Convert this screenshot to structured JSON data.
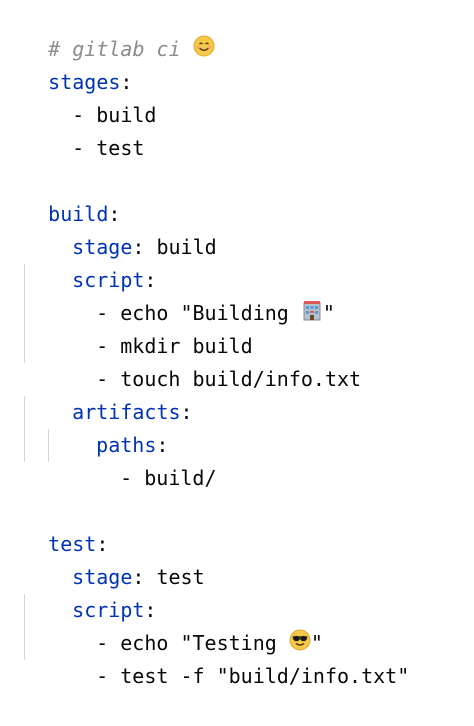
{
  "editor": {
    "language": "yaml",
    "lines": [
      {
        "id": "l1",
        "comment": "# gitlab ci ",
        "icon": "smiling-face-icon"
      },
      {
        "id": "l2",
        "key": "stages",
        "sep": ":"
      },
      {
        "id": "l3",
        "text": "- build"
      },
      {
        "id": "l4",
        "text": "- test"
      },
      {
        "id": "l5",
        "text": ""
      },
      {
        "id": "l6",
        "key": "build",
        "sep": ":"
      },
      {
        "id": "l7",
        "key": "stage",
        "sep": ":",
        "value": " build"
      },
      {
        "id": "l8",
        "key": "script",
        "sep": ":"
      },
      {
        "id": "l9",
        "text": "- echo \"Building ",
        "icon": "hotel-building-icon",
        "text_after": "\""
      },
      {
        "id": "l10",
        "text": "- mkdir build"
      },
      {
        "id": "l11",
        "text": "- touch build/info.txt"
      },
      {
        "id": "l12",
        "key": "artifacts",
        "sep": ":"
      },
      {
        "id": "l13",
        "key": "paths",
        "sep": ":"
      },
      {
        "id": "l14",
        "text": "- build/"
      },
      {
        "id": "l15",
        "text": ""
      },
      {
        "id": "l16",
        "key": "test",
        "sep": ":"
      },
      {
        "id": "l17",
        "key": "stage",
        "sep": ":",
        "value": " test"
      },
      {
        "id": "l18",
        "key": "script",
        "sep": ":"
      },
      {
        "id": "l19",
        "text": "- echo \"Testing ",
        "icon": "sunglasses-face-icon",
        "text_after": "\""
      },
      {
        "id": "l20",
        "text": "- test -f \"build/info.txt\""
      }
    ]
  }
}
